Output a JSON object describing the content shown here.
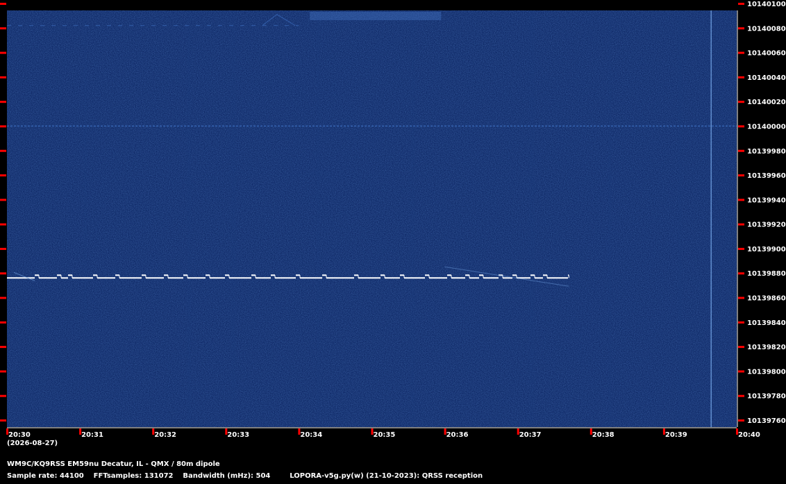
{
  "chart_data": {
    "type": "heatmap",
    "title": "",
    "x_tick_labels": [
      "20:30",
      "20:31",
      "20:32",
      "20:33",
      "20:34",
      "20:35",
      "20:36",
      "20:37",
      "20:38",
      "20:39",
      "20:40"
    ],
    "date_label": "(2026-08-27)",
    "y_tick_labels": [
      "10140100",
      "10140080",
      "10140060",
      "10140040",
      "10140020",
      "10140000",
      "10139980",
      "10139960",
      "10139940",
      "10139920",
      "10139900",
      "10139880",
      "10139860",
      "10139840",
      "10139820",
      "10139800",
      "10139780",
      "10139760"
    ],
    "ylim": [
      10139760,
      10140100
    ],
    "signals": [
      {
        "kind": "qrss-dashes",
        "freq_hz": 10139876,
        "t_start": "20:30",
        "t_end": "20:37.7"
      },
      {
        "kind": "faint-carrier",
        "freq_hz": 10140000,
        "t_start": "20:30",
        "t_end": "20:40"
      },
      {
        "kind": "faint-trace",
        "freq_hz": 10140082,
        "t_start": "20:30",
        "t_end": "20:34"
      },
      {
        "kind": "vertical-line",
        "time": "20:39.65"
      }
    ],
    "colors": {
      "background": "#0f2a66",
      "signal": "#ffffff",
      "tick": "#ff0000"
    }
  },
  "footer": {
    "station": "WM9C/KQ9RSS EM59nu Decatur, IL - QMX / 80m dipole",
    "params": "Sample rate: 44100    FFTsamples: 131072    Bandwidth (mHz): 504        LOPORA-v5g.py(w) (21-10-2023): QRSS reception"
  }
}
